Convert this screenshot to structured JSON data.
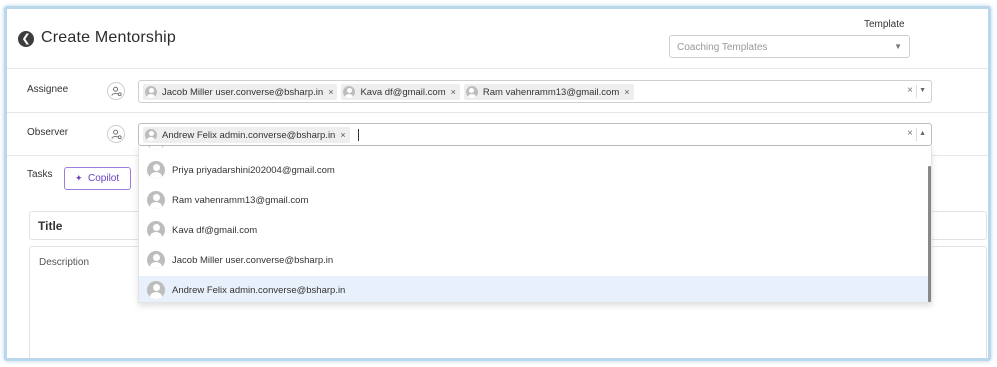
{
  "header": {
    "title": "Create Mentorship",
    "template_label": "Template",
    "template_placeholder": "Coaching Templates"
  },
  "assignee": {
    "label": "Assignee",
    "chips": [
      "Jacob Miller user.converse@bsharp.in",
      "Kava df@gmail.com",
      "Ram vahenramm13@gmail.com"
    ]
  },
  "observer": {
    "label": "Observer",
    "chips": [
      "Andrew Felix admin.converse@bsharp.in"
    ]
  },
  "tasks": {
    "label": "Tasks",
    "copilot_label": "Copilot",
    "title_label": "Title",
    "description_label": "Description"
  },
  "dropdown": {
    "options": [
      "Priya priyadarshini202004@gmail.com",
      "Ram vahenramm13@gmail.com",
      "Kava df@gmail.com",
      "Jacob Miller user.converse@bsharp.in",
      "Andrew Felix admin.converse@bsharp.in"
    ],
    "selected": "Andrew Felix admin.converse@bsharp.in"
  },
  "icons": {
    "back": "back-arrow-icon",
    "user_group": "user-settings-icon",
    "clear": "close-icon",
    "caret": "chevron-down-icon",
    "avatar": "user-avatar-icon",
    "sparkle": "sparkle-icon"
  },
  "colors": {
    "frame_border": "#b9d8ec",
    "copilot_accent": "#6a40c4",
    "selected_option_bg": "#e8f1fb"
  }
}
